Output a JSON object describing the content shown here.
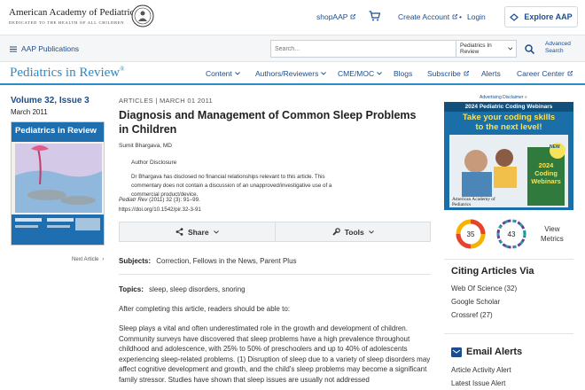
{
  "header": {
    "org_name": "American Academy of Pediatrics",
    "org_tagline": "DEDICATED TO THE HEALTH OF ALL CHILDREN",
    "shop_label": "shopAAP",
    "create_account_label": "Create Account",
    "login_label": "Login",
    "explore_label": "Explore AAP"
  },
  "subheader": {
    "publications_label": "AAP Publications",
    "search_placeholder": "Search...",
    "search_scope": "Pediatrics In Review",
    "advanced_line1": "Advanced",
    "advanced_line2": "Search"
  },
  "journal": {
    "title": "Pediatrics in Review",
    "trademark": "®",
    "nav": [
      "Content",
      "Authors/Reviewers",
      "CME/MOC",
      "Blogs",
      "Subscribe",
      "Alerts",
      "Career Center"
    ]
  },
  "issue": {
    "volume": "Volume 32, Issue 3",
    "date": "March 2011",
    "cover_title": "Pediatrics in Review",
    "next_article": "Next Article"
  },
  "article": {
    "type": "ARTICLES",
    "date": "MARCH 01 2011",
    "title": "Diagnosis and Management of Common Sleep Problems in Children",
    "author": "Sumit Bhargava, MD",
    "disclosure_label": "Author Disclosure",
    "disclosure_text": "Dr Bhargava has disclosed no financial relationships relevant to this article. This commentary does not contain a discussion of an unapproved/investigative use of a commercial product/device.",
    "citation_journal": "Pediatr Rev",
    "citation_details": "(2011) 32 (3): 91–99.",
    "doi": "https://doi.org/10.1542/pir.32-3-91",
    "share_label": "Share",
    "tools_label": "Tools",
    "subjects_label": "Subjects:",
    "subjects": "Correction, Fellows in the News, Parent Plus",
    "topics_label": "Topics:",
    "topics": "sleep, sleep disorders, snoring",
    "lead": "After completing this article, readers should be able to:",
    "paragraph": "Sleep plays a vital and often underestimated role in the growth and development of children. Community surveys have discovered that sleep problems have a high prevalence throughout childhood and adolescence, with 25% to 50% of preschoolers and up to 40% of adolescents experiencing sleep-related problems. (1) Disruption of sleep due to a variety of sleep disorders may affect cognitive development and growth, and the child's sleep problems may become a significant family stressor. Studies have shown that sleep issues are usually not addressed"
  },
  "sidebar": {
    "ad_label": "Advertising Disclaimer »",
    "ad_top": "2024 Pediatric Coding Webinars",
    "ad_headline_1": "Take your coding skills",
    "ad_headline_2": "to the next level!",
    "ad_badge": "NEW",
    "ad_promo_1": "2024",
    "ad_promo_2": "Coding",
    "ad_promo_3": "Webinars",
    "ad_org": "American Academy of Pediatrics",
    "metric_altmetric": "35",
    "metric_dimensions": "43",
    "view_metrics_1": "View",
    "view_metrics_2": "Metrics",
    "citing_title": "Citing Articles Via",
    "citing_items": [
      "Web Of Science (32)",
      "Google Scholar",
      "Crossref (27)"
    ],
    "email_title": "Email Alerts",
    "email_items": [
      "Article Activity Alert",
      "Latest Issue Alert"
    ]
  },
  "colors": {
    "link": "#1a4d8f",
    "journal_accent": "#2a8cc9",
    "ad_blue": "#1a6fa8",
    "ad_yellow": "#f7e35a"
  }
}
